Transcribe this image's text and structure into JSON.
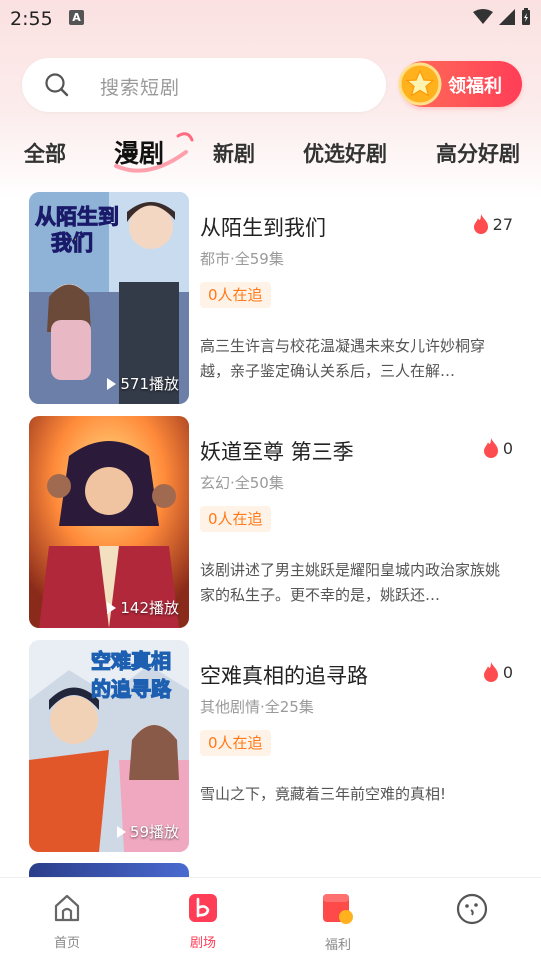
{
  "status_bar": {
    "time": "2:55",
    "notification_letter": "A"
  },
  "search": {
    "placeholder": "搜索短剧"
  },
  "welfare_button": {
    "label": "领福利"
  },
  "tabs": [
    {
      "label": "全部",
      "active": false
    },
    {
      "label": "漫剧",
      "active": true
    },
    {
      "label": "新剧",
      "active": false
    },
    {
      "label": "优选好剧",
      "active": false
    },
    {
      "label": "高分好剧",
      "active": false
    }
  ],
  "items": [
    {
      "title": "从陌生到我们",
      "meta": "都市·全59集",
      "follow": "0人在追",
      "description": "高三生许言与校花温凝遇未来女儿许妙桐穿越，亲子鉴定确认关系后，三人在解…",
      "heat": "27",
      "plays": "571播放",
      "cover_title": "从陌生到我们"
    },
    {
      "title": "妖道至尊 第三季",
      "meta": "玄幻·全50集",
      "follow": "0人在追",
      "description": "该剧讲述了男主姚跃是耀阳皇城内政治家族姚家的私生子。更不幸的是，姚跃还…",
      "heat": "0",
      "plays": "142播放",
      "cover_title": ""
    },
    {
      "title": "空难真相的追寻路",
      "meta": "其他剧情·全25集",
      "follow": "0人在追",
      "description": "雪山之下，竟藏着三年前空难的真相!",
      "heat": "0",
      "plays": "59播放",
      "cover_title": "空难真相的追寻路"
    }
  ],
  "bottom_nav": [
    {
      "label": "首页",
      "icon": "home-icon",
      "active": false
    },
    {
      "label": "剧场",
      "icon": "theater-icon",
      "active": true
    },
    {
      "label": "福利",
      "icon": "gift-icon",
      "active": false
    },
    {
      "label": "",
      "icon": "profile-face-icon",
      "active": false
    }
  ],
  "colors": {
    "accent": "#ff3d57",
    "follow_badge_text": "#ff7a1a",
    "follow_badge_bg": "#fff2e6",
    "heat_flame": "#ff4d4f"
  }
}
